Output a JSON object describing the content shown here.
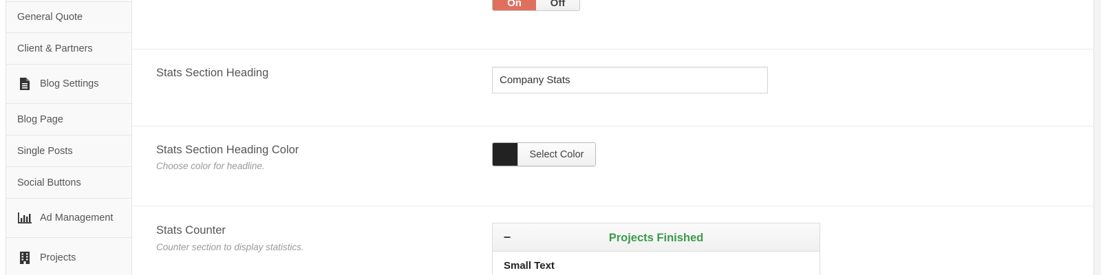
{
  "sidebar": {
    "items": [
      {
        "label": "General Quote",
        "icon": null
      },
      {
        "label": "Client & Partners",
        "icon": null
      },
      {
        "label": "Blog Settings",
        "icon": "document-icon"
      },
      {
        "label": "Blog Page",
        "icon": null
      },
      {
        "label": "Single Posts",
        "icon": null
      },
      {
        "label": "Social Buttons",
        "icon": null
      },
      {
        "label": "Ad Management",
        "icon": "bar-chart-icon"
      },
      {
        "label": "Projects",
        "icon": "building-icon"
      }
    ]
  },
  "top_switch": {
    "on_label": "On",
    "off_label": "Off",
    "on_color": "#e0705e"
  },
  "stats_heading": {
    "label": "Stats Section Heading",
    "value": "Company Stats"
  },
  "stats_heading_color": {
    "label": "Stats Section Heading Color",
    "description": "Choose color for headline.",
    "button_label": "Select Color",
    "swatch_color": "#222222"
  },
  "stats_counter": {
    "label": "Stats Counter",
    "description": "Counter section to display statistics.",
    "panel": {
      "toggle": "–",
      "title": "Projects Finished",
      "title_color": "#3a9a4a",
      "field_label": "Small Text"
    }
  }
}
